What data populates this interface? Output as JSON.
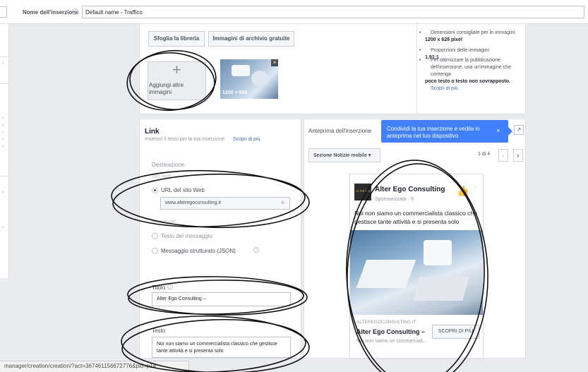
{
  "header": {
    "name_label": "Nome dell'inserzione",
    "name_value": "Default name - Traffico"
  },
  "images": {
    "tab_library": "Sfoglia la libreria",
    "tab_free": "Immagini di archivio gratuite",
    "add_label": "Aggiungi altre immagini",
    "thumb_size": "1200 × 628",
    "requirements": [
      {
        "pre": "Dimensioni consigliate per le immagini: ",
        "bold": "1200 x 628 pixel",
        "post": "",
        "link": ""
      },
      {
        "pre": "Proporzioni delle immagini: ",
        "bold": "1,91:1",
        "post": "",
        "link": ""
      },
      {
        "pre": "Per ottimizzare la pubblicazione dell'inserzione, usa un'immagine che contenga ",
        "bold": "poco testo o testo non sovrapposto.",
        "post": " ",
        "link": "Scopri di più."
      }
    ]
  },
  "link_section": {
    "title": "Link",
    "help": "Inserisci il testo per la tua inserzione.",
    "help_link": "Scopri di più.",
    "destination_label": "Destinazione",
    "website_label": "Sito Web",
    "url_option": "URL del sito Web",
    "url_value": "www.alteregoconsulting.it",
    "messenger_label": "Messenger",
    "msg_text_option": "Testo del messaggio",
    "msg_json_option": "Messaggio strutturato (JSON)",
    "title_label": "Titolo",
    "title_value": "Alter Ego Consulting –",
    "text_label": "Testo",
    "text_value": "Noi non siamo un commercialista classico che gestisce tante attività e si presenta solo"
  },
  "preview": {
    "label": "Anteprima dell'inserzione",
    "share_text": "Condividi la tua inserzione e vedila in anteprima nel tuo dispositivo",
    "placement": "Sezione Notizie mobile",
    "page_count": "1 di 4"
  },
  "ad": {
    "page_name": "Alter Ego Consulting",
    "sponsored": "Sponsorizzata · ⚲",
    "body": "Noi non siamo un commercialista classico che gestisce tante attività e si presenta solo",
    "domain": "ALTEREGOCONSULTING.IT",
    "headline": "Alter Ego Consulting –",
    "description": "Noi non siamo un commerciali...",
    "cta": "SCOPRI DI PIÙ",
    "logo_mark": "ALTER EGO"
  },
  "status_url": "manager/creation/creation/?act=367461156672776&pid=p1#",
  "colors": {
    "accent": "#4080ff",
    "link": "#4267b2",
    "background": "#e9ebee"
  }
}
